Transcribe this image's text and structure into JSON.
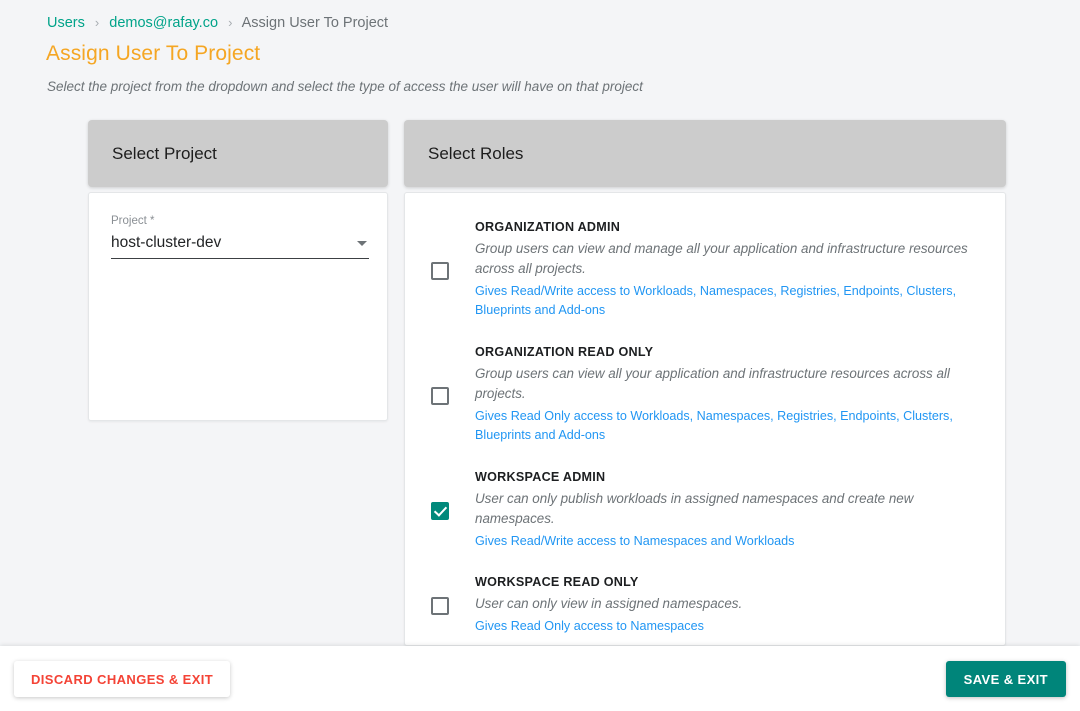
{
  "breadcrumb": {
    "items": [
      {
        "label": "Users",
        "type": "link"
      },
      {
        "label": "demos@rafay.co",
        "type": "link"
      },
      {
        "label": "Assign User To Project",
        "type": "current"
      }
    ],
    "separator": "›"
  },
  "header": {
    "title": "Assign User To Project",
    "subtitle": "Select the project from the dropdown and select the type of access the user will have on that project",
    "title_color": "#f5a623",
    "link_color": "#00a389"
  },
  "project_section": {
    "heading": "Select Project",
    "field": {
      "label": "Project *",
      "value": "host-cluster-dev",
      "caret_icon": "chevron-down-icon"
    }
  },
  "roles_section": {
    "heading": "Select Roles",
    "link_color": "#2196f3",
    "checked_color": "#00897b",
    "roles": [
      {
        "name": "ORGANIZATION ADMIN",
        "description": "Group users can view and manage all your application and infrastructure resources across all projects.",
        "access": "Gives Read/Write access to Workloads, Namespaces, Registries, Endpoints, Clusters, Blueprints and Add-ons",
        "checked": false
      },
      {
        "name": "ORGANIZATION READ ONLY",
        "description": "Group users can view all your application and infrastructure resources across all projects.",
        "access": "Gives Read Only access to Workloads, Namespaces, Registries, Endpoints, Clusters, Blueprints and Add-ons",
        "checked": false
      },
      {
        "name": "WORKSPACE ADMIN",
        "description": "User can only publish workloads in assigned namespaces and create new namespaces.",
        "access": "Gives Read/Write access to Namespaces and Workloads",
        "checked": true
      },
      {
        "name": "WORKSPACE READ ONLY",
        "description": "User can only view in assigned namespaces.",
        "access": "Gives Read Only access to Namespaces",
        "checked": false
      }
    ]
  },
  "footer": {
    "discard_label": "DISCARD CHANGES & EXIT",
    "save_label": "SAVE & EXIT",
    "discard_color": "#f44336",
    "save_bg": "#00857a"
  }
}
